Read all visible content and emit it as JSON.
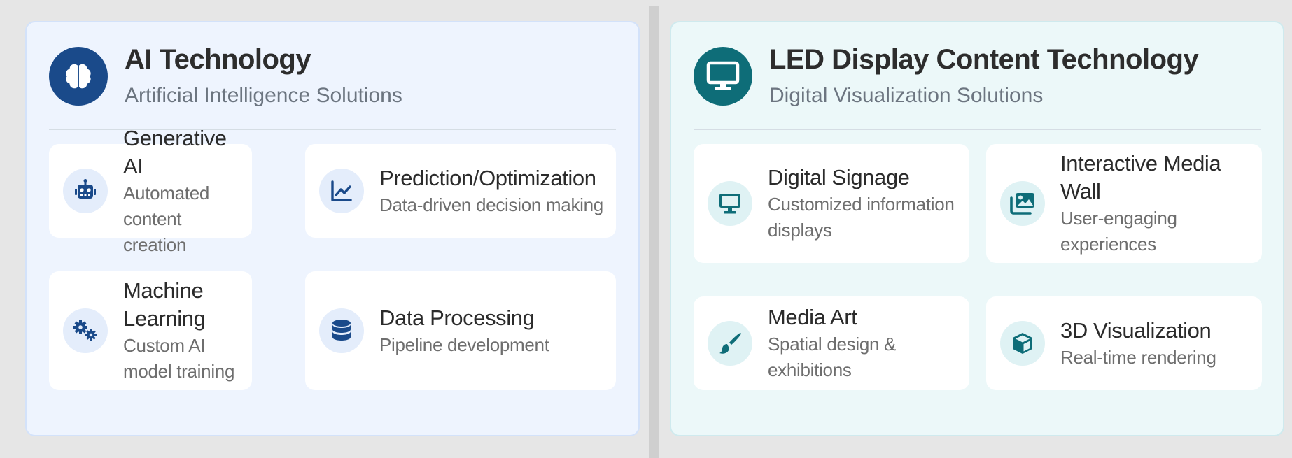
{
  "colors": {
    "ai_accent": "#1a4a8a",
    "led_accent": "#0e6d78",
    "ai_panel_bg": "#eef4fe",
    "led_panel_bg": "#ecf8f9"
  },
  "ai_panel": {
    "title": "AI Technology",
    "subtitle": "Artificial Intelligence Solutions",
    "icon": "brain-icon",
    "cards": [
      {
        "title": "Generative AI",
        "description": "Automated content creation",
        "icon": "robot-icon"
      },
      {
        "title": "Prediction/Optimization",
        "description": "Data-driven decision making",
        "icon": "line-chart-icon"
      },
      {
        "title": "Machine Learning",
        "description": "Custom AI model training",
        "icon": "gears-icon"
      },
      {
        "title": "Data Processing",
        "description": "Pipeline development",
        "icon": "database-icon"
      }
    ]
  },
  "led_panel": {
    "title": "LED Display Content Technology",
    "subtitle": "Digital Visualization Solutions",
    "icon": "monitor-icon",
    "cards": [
      {
        "title": "Digital Signage",
        "description": "Customized information displays",
        "icon": "monitor-icon"
      },
      {
        "title": "Interactive Media Wall",
        "description": "User-engaging experiences",
        "icon": "images-icon"
      },
      {
        "title": "Media Art",
        "description": "Spatial design & exhibitions",
        "icon": "paintbrush-icon"
      },
      {
        "title": "3D Visualization",
        "description": "Real-time rendering",
        "icon": "cube-icon"
      }
    ]
  }
}
